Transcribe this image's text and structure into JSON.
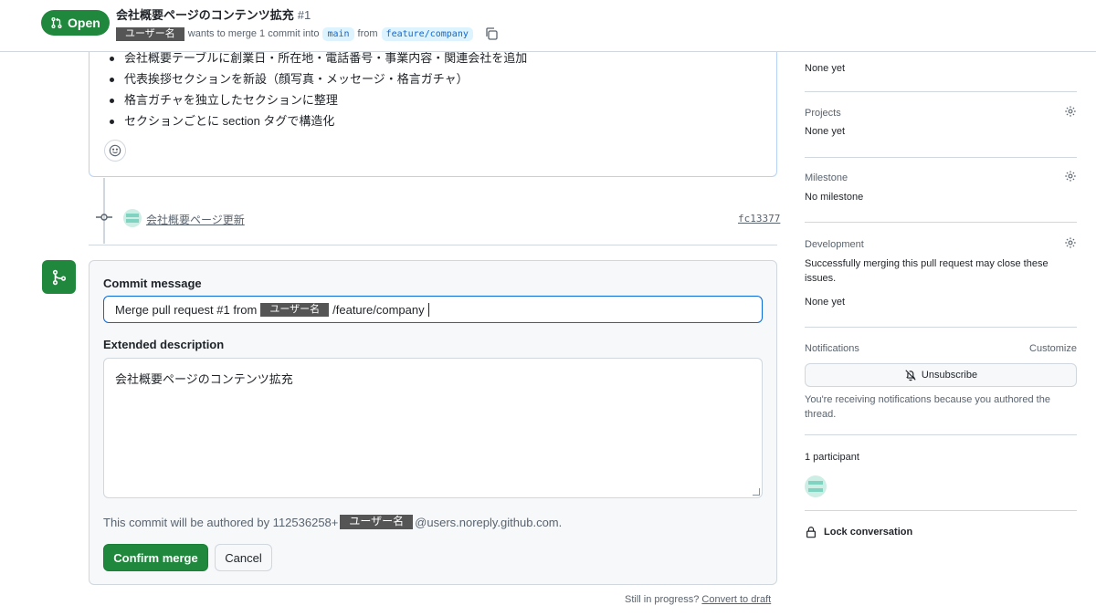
{
  "header": {
    "state": "Open",
    "title": "会社概要ページのコンテンツ拡充",
    "number": "#1",
    "author": "ユーザー名",
    "merge_text": "wants to merge 1 commit into",
    "base_branch": "main",
    "from_text": "from",
    "head_branch": "feature/company"
  },
  "body": {
    "bullets": [
      "会社概要テーブルに創業日・所在地・電話番号・事業内容・関連会社を追加",
      "代表挨拶セクションを新設（顔写真・メッセージ・格言ガチャ）",
      "格言ガチャを独立したセクションに整理",
      "セクションごとに section タグで構造化"
    ]
  },
  "commit": {
    "message": "会社概要ページ更新",
    "sha": "fc13377"
  },
  "merge": {
    "commit_label": "Commit message",
    "commit_prefix": "Merge pull request #1 from",
    "commit_user": "ユーザー名",
    "commit_suffix": "/feature/company",
    "desc_label": "Extended description",
    "desc_value": "会社概要ページのコンテンツ拡充",
    "authored_prefix": "This commit will be authored by 112536258+",
    "authored_user": "ユーザー名",
    "authored_suffix": "@users.noreply.github.com.",
    "confirm_label": "Confirm merge",
    "cancel_label": "Cancel",
    "draft_text": "Still in progress?",
    "draft_link": "Convert to draft"
  },
  "sidebar": {
    "reviewers_value": "None yet",
    "projects_title": "Projects",
    "projects_value": "None yet",
    "milestone_title": "Milestone",
    "milestone_value": "No milestone",
    "development_title": "Development",
    "development_note": "Successfully merging this pull request may close these issues.",
    "development_value": "None yet",
    "notifications_title": "Notifications",
    "customize": "Customize",
    "unsubscribe": "Unsubscribe",
    "notify_note": "You're receiving notifications because you authored the thread.",
    "participants": "1 participant",
    "lock": "Lock conversation"
  },
  "colors": {
    "green": "#1f883d",
    "blue": "#0969da",
    "border": "#d0d7de"
  }
}
